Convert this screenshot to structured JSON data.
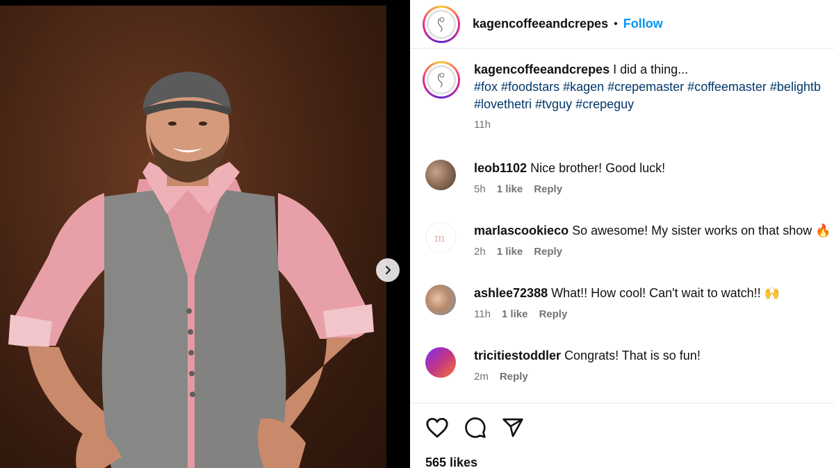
{
  "post": {
    "username": "kagencoffeeandcrepes",
    "separator": "•",
    "follow_label": "Follow"
  },
  "caption": {
    "username": "kagencoffeeandcrepes",
    "text": "I did a thing...",
    "hashtags_line1": "#fox #foodstars #kagen #crepemaster #coffeemaster #belightb",
    "hashtags_line2": "#lovethetri #tvguy #crepeguy",
    "time": "11h"
  },
  "comments": [
    {
      "username": "leob1102",
      "text": "Nice brother! Good luck!",
      "time": "5h",
      "likes": "1 like",
      "reply": "Reply"
    },
    {
      "username": "marlascookieco",
      "text": "So awesome! My sister works on that show 🔥",
      "time": "2h",
      "likes": "1 like",
      "reply": "Reply"
    },
    {
      "username": "ashlee72388",
      "text": "What!! How cool! Can't wait to watch!! 🙌",
      "time": "11h",
      "likes": "1 like",
      "reply": "Reply"
    },
    {
      "username": "tricitiestoddler",
      "text": "Congrats! That is so fun!",
      "time": "2m",
      "reply": "Reply"
    }
  ],
  "likes_count": "565 likes",
  "icons": {
    "like": "heart-icon",
    "comment": "comment-icon",
    "share": "share-icon",
    "next": "chevron-right-icon"
  },
  "colors": {
    "follow": "#0095f6",
    "hashtag": "#00376b",
    "meta": "#737373"
  }
}
